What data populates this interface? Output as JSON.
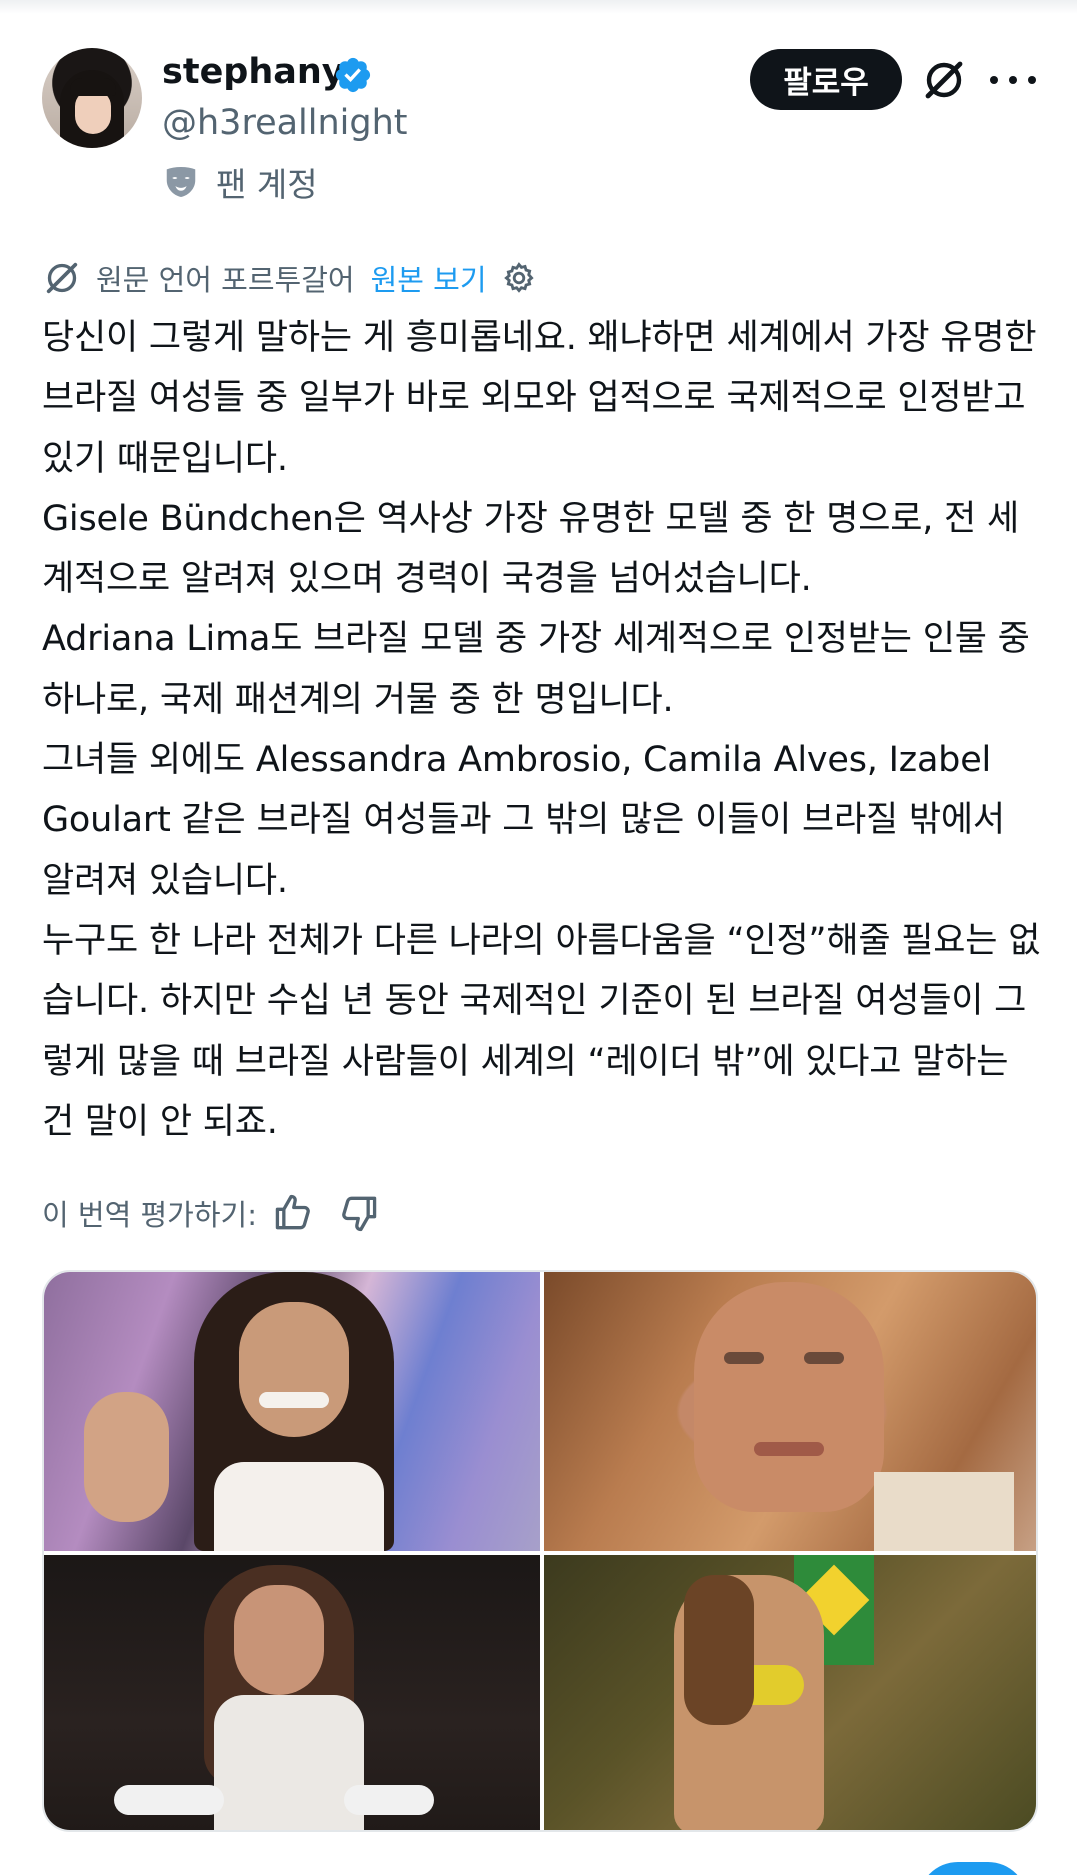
{
  "header": {
    "display_name": "stephany",
    "handle": "@h3reallnight",
    "account_type": "팬 계정",
    "follow_label": "팔로우",
    "icons": {
      "verified": "verified-badge-icon",
      "fan": "mask-icon",
      "grok": "grok-icon",
      "more": "more-icon"
    },
    "colors": {
      "verified": "#1d9bf0",
      "follow_bg": "#0f1419"
    }
  },
  "translation": {
    "label": "원문 언어 포르투갈어",
    "show_original": "원본 보기",
    "link_color": "#1d9bf0"
  },
  "tweet": {
    "text": "당신이 그렇게 말하는 게 흥미롭네요. 왜냐하면 세계에서 가장 유명한 브라질 여성들 중 일부가 바로 외모와 업적으로 국제적으로 인정받고 있기 때문입니다.\nGisele Bündchen은 역사상 가장 유명한 모델 중 한 명으로, 전 세계적으로 알려져 있으며 경력이 국경을 넘어섰습니다.\nAdriana Lima도 브라질 모델 중 가장 세계적으로 인정받는 인물 중 하나로, 국제 패션계의 거물 중 한 명입니다.\n그녀들 외에도 Alessandra Ambrosio, Camila Alves, Izabel Goulart 같은 브라질 여성들과 그 밖의 많은 이들이 브라질 밖에서 알려져 있습니다.\n누구도 한 나라 전체가 다른 나라의 아름다움을 “인정”해줄 필요는 없습니다. 하지만 수십 년 동안 국제적인 기준이 된 브라질 여성들이 그렇게 많을 때 브라질 사람들이 세계의 “레이더 밖”에 있다고 말하는 건 말이 안 되죠."
  },
  "rating": {
    "label": "이 번역 평가하기:",
    "icons": [
      "thumbs-up-icon",
      "thumbs-down-icon"
    ]
  },
  "media": {
    "count": 4
  }
}
